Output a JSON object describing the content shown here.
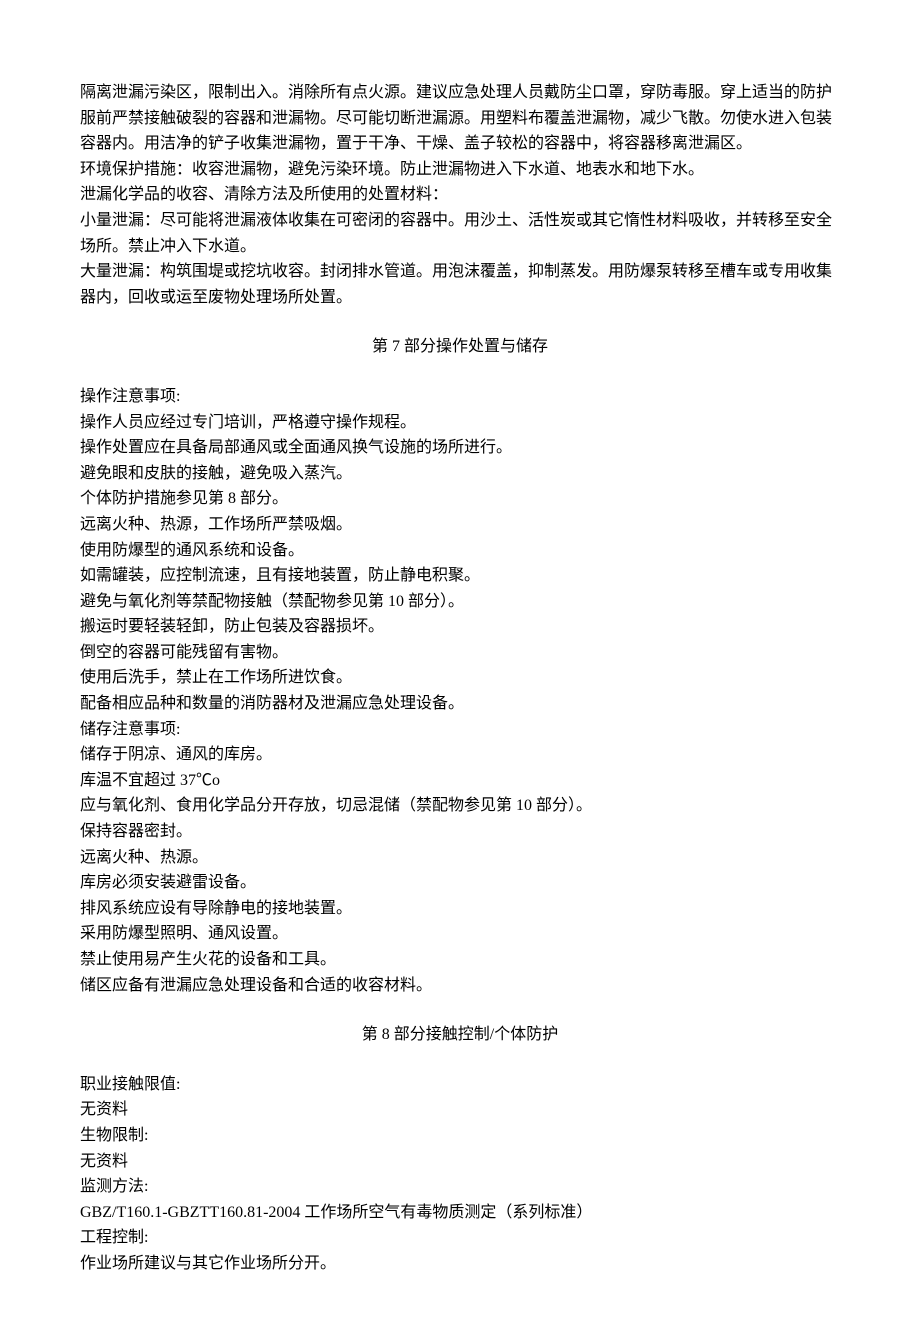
{
  "intro": {
    "p1": "隔离泄漏污染区，限制出入。消除所有点火源。建议应急处理人员戴防尘口罩，穿防毒服。穿上适当的防护服前严禁接触破裂的容器和泄漏物。尽可能切断泄漏源。用塑料布覆盖泄漏物，减少飞散。勿使水进入包装容器内。用洁净的铲子收集泄漏物，置于干净、干燥、盖子较松的容器中，将容器移离泄漏区。",
    "p2": "环境保护措施：收容泄漏物，避免污染环境。防止泄漏物进入下水道、地表水和地下水。",
    "p3": "泄漏化学品的收容、清除方法及所使用的处置材料：",
    "p4": "小量泄漏：尽可能将泄漏液体收集在可密闭的容器中。用沙土、活性炭或其它惰性材料吸收，并转移至安全场所。禁止冲入下水道。",
    "p5": "大量泄漏：构筑围堤或挖坑收容。封闭排水管道。用泡沫覆盖，抑制蒸发。用防爆泵转移至槽车或专用收集器内，回收或运至废物处理场所处置。"
  },
  "section7": {
    "title": "第 7 部分操作处置与储存",
    "lines": [
      "操作注意事项:",
      "操作人员应经过专门培训，严格遵守操作规程。",
      "操作处置应在具备局部通风或全面通风换气设施的场所进行。",
      "避免眼和皮肤的接触，避免吸入蒸汽。",
      "个体防护措施参见第 8 部分。",
      "远离火种、热源，工作场所严禁吸烟。",
      "使用防爆型的通风系统和设备。",
      "如需罐装，应控制流速，且有接地装置，防止静电积聚。",
      "避免与氧化剂等禁配物接触（禁配物参见第 10 部分）。",
      "搬运时要轻装轻卸，防止包装及容器损坏。",
      "倒空的容器可能残留有害物。",
      "使用后洗手，禁止在工作场所进饮食。",
      "配备相应品种和数量的消防器材及泄漏应急处理设备。",
      "储存注意事项:",
      "储存于阴凉、通风的库房。",
      "库温不宜超过 37℃o",
      "应与氧化剂、食用化学品分开存放，切忌混储（禁配物参见第 10 部分）。",
      "保持容器密封。",
      "远离火种、热源。",
      "库房必须安装避雷设备。",
      "排风系统应设有导除静电的接地装置。",
      "采用防爆型照明、通风设置。",
      "禁止使用易产生火花的设备和工具。",
      "储区应备有泄漏应急处理设备和合适的收容材料。"
    ]
  },
  "section8": {
    "title": "第 8 部分接触控制/个体防护",
    "lines": [
      "职业接触限值:",
      "无资料",
      "生物限制:",
      "无资料",
      "监测方法:",
      "GBZ/T160.1-GBZTT160.81-2004 工作场所空气有毒物质测定（系列标准）",
      "工程控制:",
      "作业场所建议与其它作业场所分开。"
    ]
  }
}
